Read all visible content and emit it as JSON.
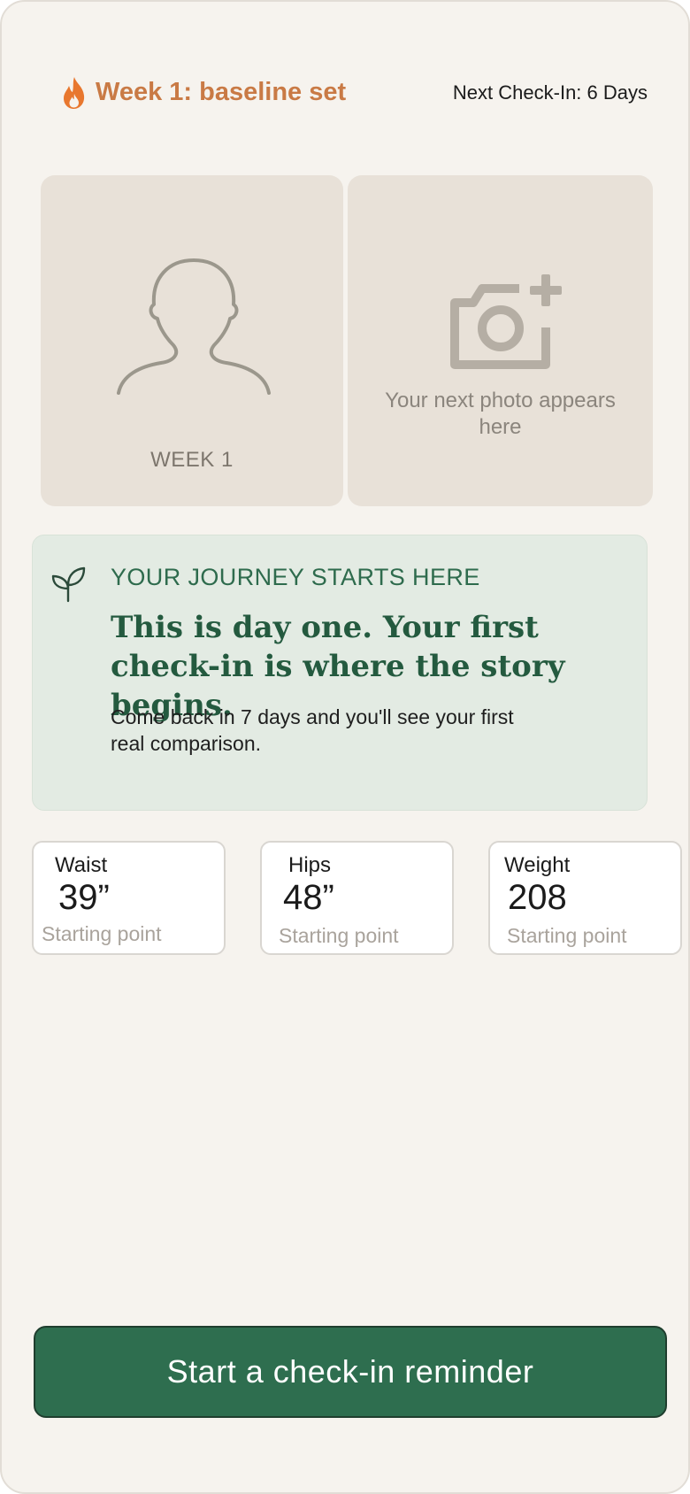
{
  "header": {
    "week_title": "Week 1: baseline set",
    "next_checkin": "Next Check-In: 6 Days",
    "accent_color": "#c97a45",
    "icon": "flame-icon"
  },
  "photos": {
    "left_label": "WEEK 1",
    "left_icon": "person-silhouette-icon",
    "right_text": "Your next photo appears here",
    "right_icon": "camera-plus-icon"
  },
  "journey": {
    "eyebrow": "YOUR JOURNEY STARTS HERE",
    "headline": "This is day one. Your first check-in is where the story begins.",
    "body": "Come back in 7 days and you'll see your first real comparison.",
    "icon": "sprout-icon",
    "background_color": "#e3ebe3",
    "text_color": "#245a3f"
  },
  "metrics": [
    {
      "label": "Waist",
      "value": "39”",
      "note": "Starting point"
    },
    {
      "label": "Hips",
      "value": "48”",
      "note": "Starting point"
    },
    {
      "label": "Weight",
      "value": "208",
      "note": "Starting point"
    }
  ],
  "cta": {
    "label": "Start a check-in reminder",
    "color": "#2e6e4f"
  }
}
